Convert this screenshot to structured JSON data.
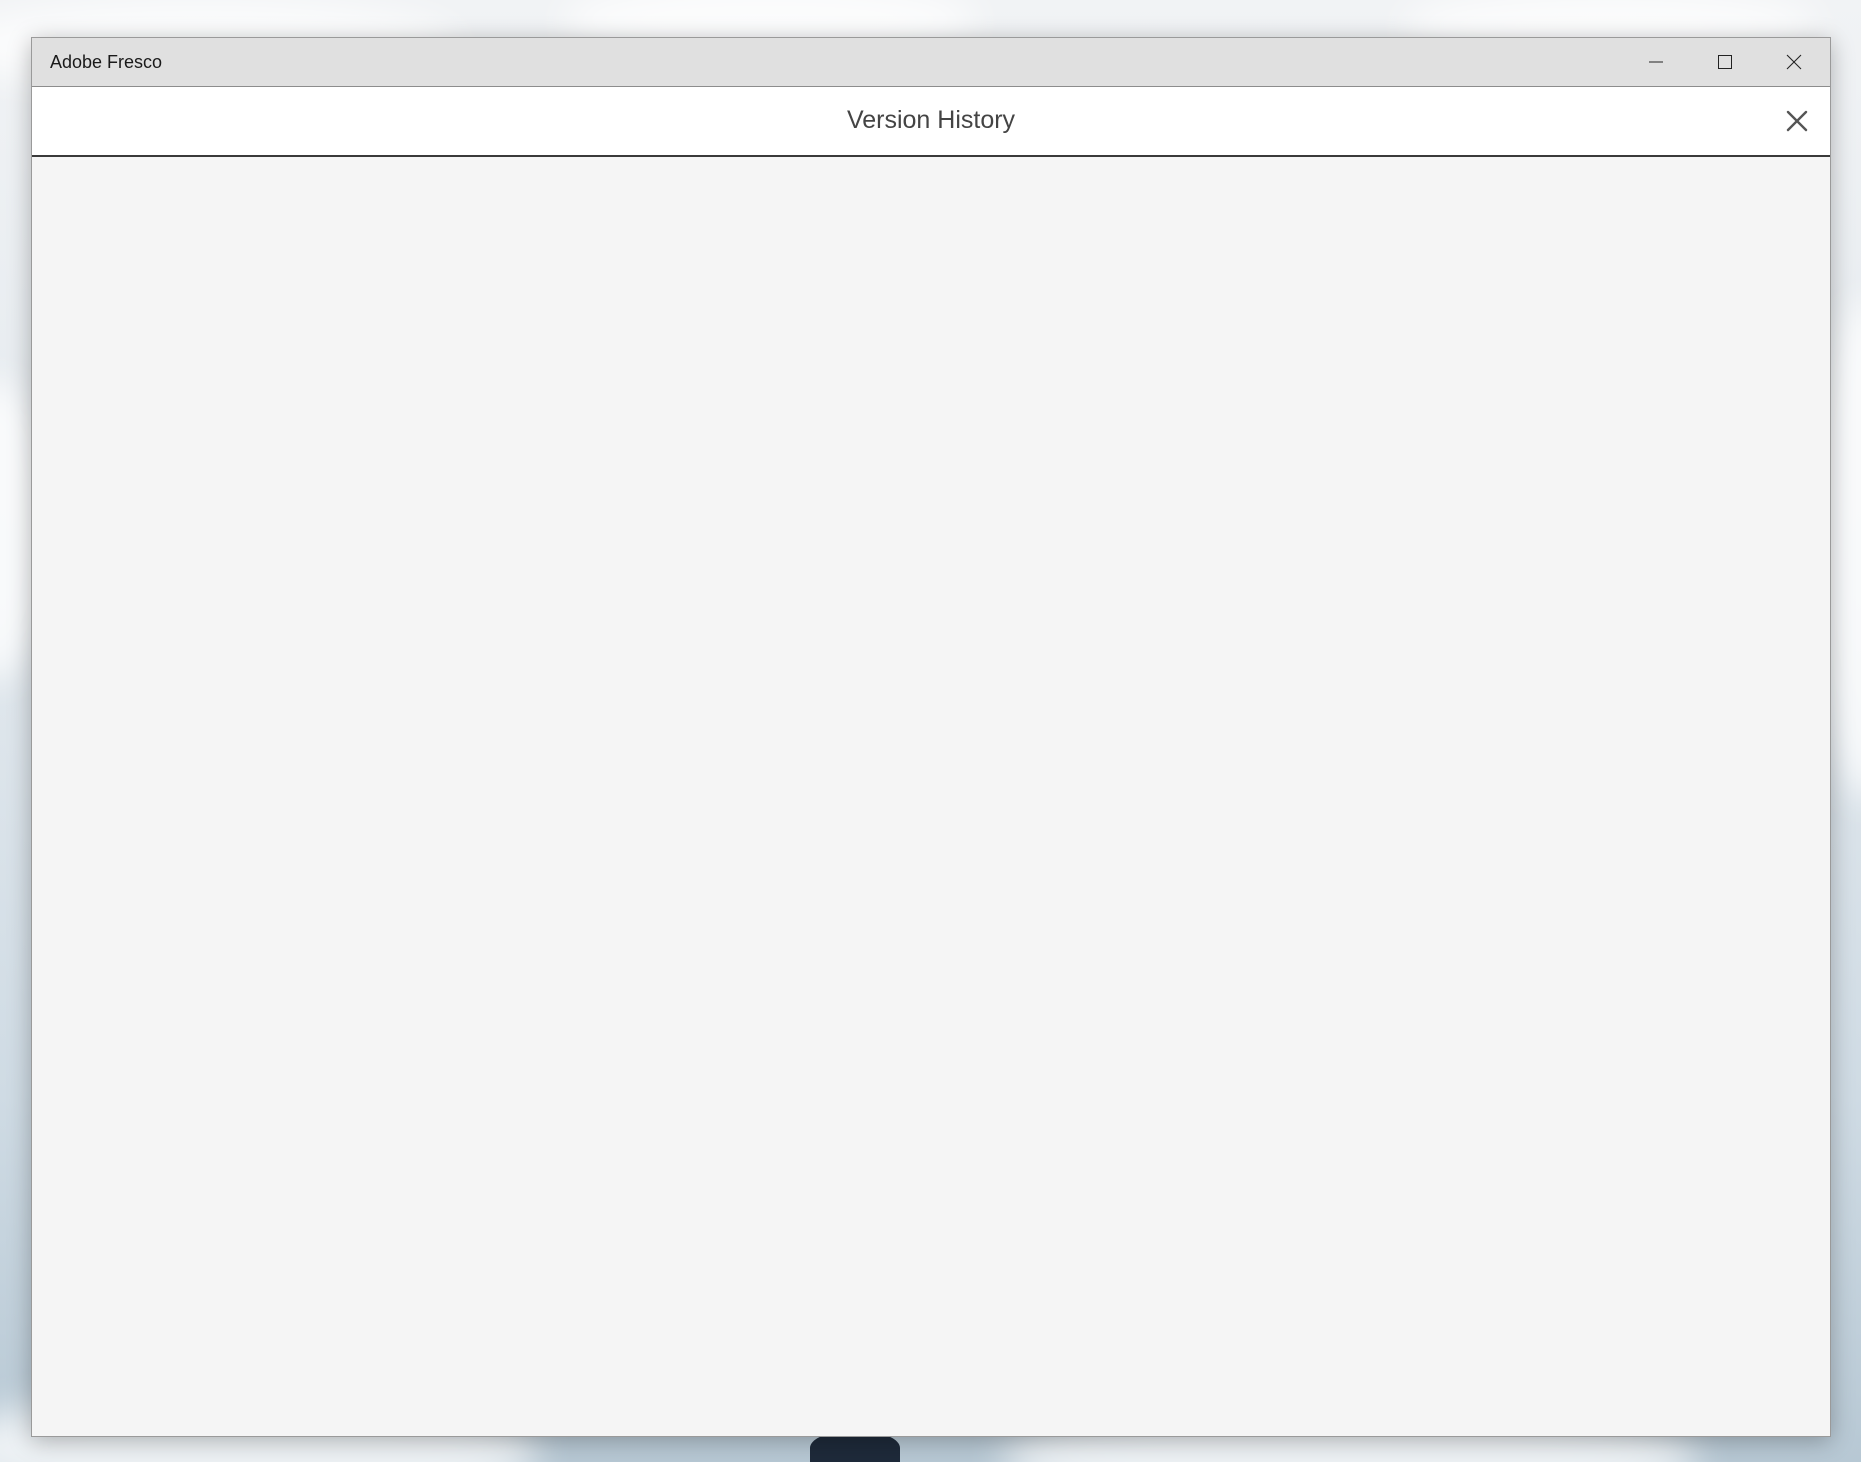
{
  "window": {
    "app_title": "Adobe Fresco",
    "controls": {
      "minimize_icon": "minimize-icon",
      "maximize_icon": "maximize-icon",
      "close_icon": "close-icon"
    }
  },
  "dialog": {
    "title": "Version History",
    "close_icon": "close-icon",
    "content_items": []
  },
  "colors": {
    "titlebar_bg": "#e0e0e0",
    "header_bg": "#ffffff",
    "content_bg": "#f5f5f5",
    "title_text": "#444444",
    "icon_color": "#555555"
  }
}
